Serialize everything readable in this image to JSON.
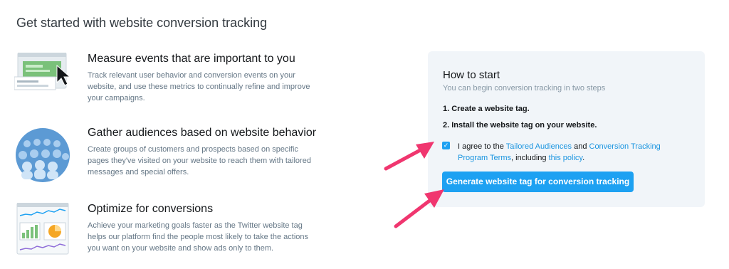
{
  "page": {
    "title": "Get started with website conversion tracking"
  },
  "features": [
    {
      "icon": "website-events-illustration",
      "title": "Measure events that are important to you",
      "desc": "Track relevant user behavior and conversion events on your website, and use these metrics to continually refine and improve your campaigns."
    },
    {
      "icon": "audience-people-illustration",
      "title": "Gather audiences based on website behavior",
      "desc": "Create groups of customers and prospects based on specific pages they've visited on your website to reach them with tailored messages and special offers."
    },
    {
      "icon": "analytics-charts-illustration",
      "title": "Optimize for conversions",
      "desc": "Achieve your marketing goals faster as the Twitter website tag helps our platform find the people most likely to take the actions you want on your website and show ads only to them."
    }
  ],
  "how_to_start": {
    "title": "How to start",
    "subtitle": "You can begin conversion tracking in two steps",
    "step1": "1. Create a website tag.",
    "step2": "2. Install the website tag on your website.",
    "agree": {
      "checked": true,
      "prefix": "I agree to the ",
      "link1": "Tailored Audiences",
      "middle": " and ",
      "link2": "Conversion Tracking Program Terms",
      "suffix1": ", including ",
      "link3": "this policy",
      "suffix2": "."
    },
    "button": "Generate website tag for conversion tracking"
  },
  "colors": {
    "accent": "#1da1f2",
    "link": "#1b95e0",
    "annotation_arrow": "#f0366f"
  }
}
